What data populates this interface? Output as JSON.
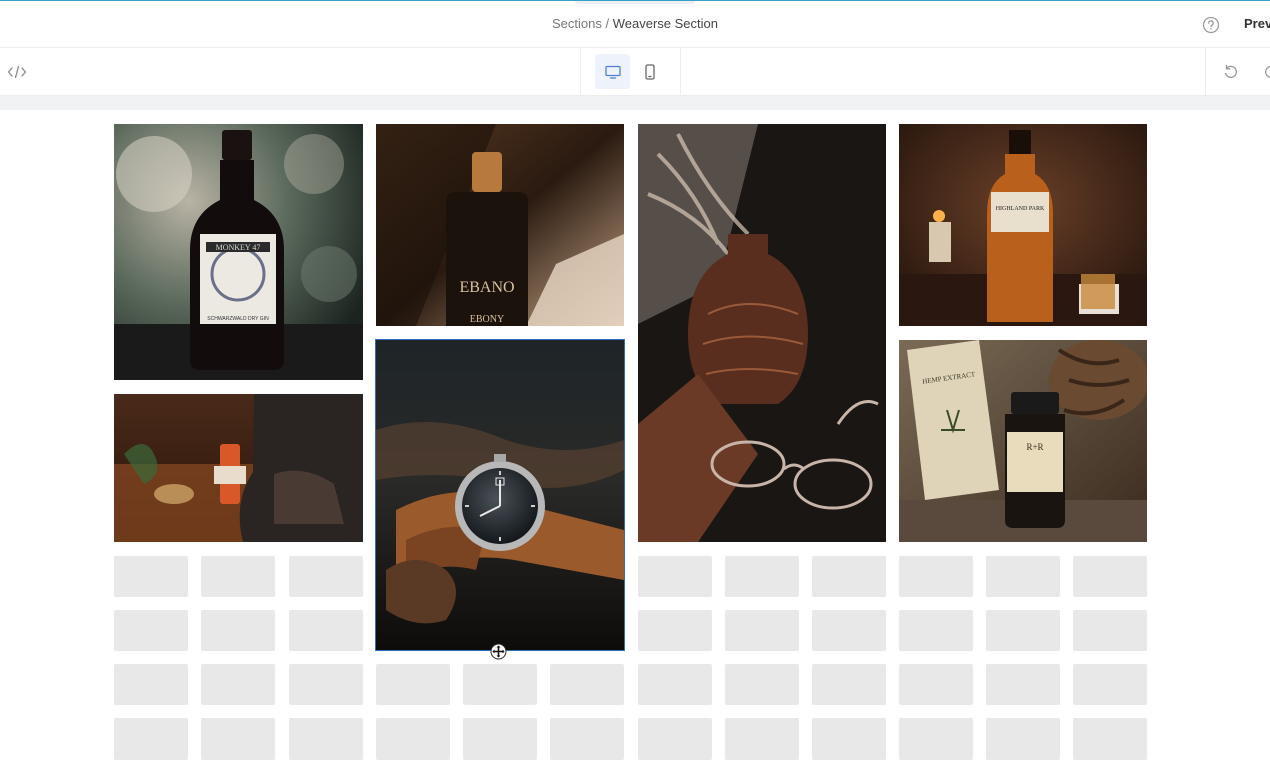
{
  "header": {
    "breadcrumb_parent": "Sections",
    "breadcrumb_separator": " / ",
    "breadcrumb_current": "Weaverse Section",
    "help_icon": "help-circle-icon",
    "preview_label": "Prev"
  },
  "toolbar": {
    "code_icon": "code-icon",
    "devices": [
      {
        "name": "desktop",
        "icon": "desktop-icon",
        "active": true
      },
      {
        "name": "mobile",
        "icon": "mobile-icon",
        "active": false
      }
    ],
    "undo_icon": "undo-icon",
    "redo_icon": "redo-icon"
  },
  "gallery": {
    "images": [
      {
        "name": "gin-bottle-image",
        "subject": "MONKEY 47",
        "subtext": "SCHWARZWALD DRY GIN"
      },
      {
        "name": "ebano-perfume-image",
        "subject": "EBANO",
        "subtext": "EBONY"
      },
      {
        "name": "vase-glasses-image"
      },
      {
        "name": "whisky-bottle-image",
        "subject": "HIGHLAND PARK"
      },
      {
        "name": "bar-scene-image"
      },
      {
        "name": "wristwatch-image",
        "selected": true
      },
      {
        "name": "hemp-extract-image",
        "subject": "HEMP EXTRACT",
        "subtext": "R+R"
      }
    ]
  },
  "colors": {
    "accent": "#2d6fbf",
    "topline": "#3aa0c8",
    "skeleton": "#e8e8e8",
    "canvas_strip": "#f1f2f3"
  }
}
